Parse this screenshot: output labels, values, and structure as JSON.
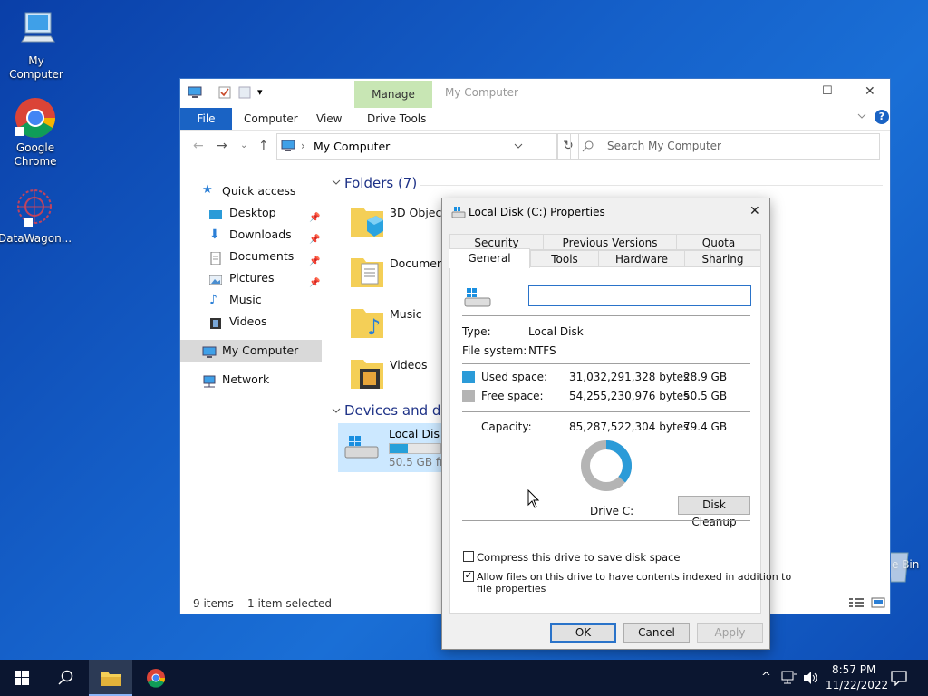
{
  "desktop": {
    "icons": [
      {
        "label": "My Computer"
      },
      {
        "label": "Google Chrome"
      },
      {
        "label": "DataWagon..."
      },
      {
        "label": "e Bin"
      }
    ]
  },
  "explorer": {
    "quick_access_toolbar": {
      "dropdown": "▾"
    },
    "contextual_tab": "Manage",
    "window_title": "My Computer",
    "controls": {
      "minimize": "—",
      "maximize": "☐",
      "close": "✕"
    },
    "ribbon_tabs": [
      "File",
      "Computer",
      "View",
      "Drive Tools"
    ],
    "help": "?",
    "address": {
      "path": "My Computer",
      "separator": "›"
    },
    "search": {
      "placeholder": "Search My Computer"
    },
    "nav": {
      "items": [
        {
          "label": "Quick access",
          "pinned": false
        },
        {
          "label": "Desktop",
          "pinned": true
        },
        {
          "label": "Downloads",
          "pinned": true
        },
        {
          "label": "Documents",
          "pinned": true
        },
        {
          "label": "Pictures",
          "pinned": true
        },
        {
          "label": "Music",
          "pinned": false
        },
        {
          "label": "Videos",
          "pinned": false
        },
        {
          "label": "My Computer",
          "pinned": false
        },
        {
          "label": "Network",
          "pinned": false
        }
      ]
    },
    "folders_header": "Folders (7)",
    "folders": [
      "3D Objects",
      "Documents",
      "Music",
      "Videos"
    ],
    "devices_header": "Devices and drives",
    "drive": {
      "name": "Local Disk (C:)",
      "free": "50.5 GB free of 79.4 GB",
      "used_fraction": 0.364
    },
    "status": {
      "items": "9 items",
      "selected": "1 item selected"
    }
  },
  "dialog": {
    "title": "Local Disk (C:) Properties",
    "close": "✕",
    "tabs_top": [
      "Security",
      "Previous Versions",
      "Quota"
    ],
    "tabs_bottom": [
      "General",
      "Tools",
      "Hardware",
      "Sharing"
    ],
    "name_value": "",
    "type_label": "Type:",
    "type_value": "Local Disk",
    "fs_label": "File system:",
    "fs_value": "NTFS",
    "used_label": "Used space:",
    "used_bytes": "31,032,291,328 bytes",
    "used_gb": "28.9 GB",
    "free_label": "Free space:",
    "free_bytes": "54,255,230,976 bytes",
    "free_gb": "50.5 GB",
    "capacity_label": "Capacity:",
    "capacity_bytes": "85,287,522,304 bytes",
    "capacity_gb": "79.4 GB",
    "drive_label": "Drive C:",
    "cleanup_button": "Disk Cleanup",
    "compress_label": "Compress this drive to save disk space",
    "compress_checked": false,
    "index_label_1": "Allow files on this drive to have contents indexed in addition to",
    "index_label_2": "file properties",
    "index_checked": true,
    "check_mark": "✓",
    "ok": "OK",
    "cancel": "Cancel",
    "apply": "Apply",
    "colors": {
      "used": "#2b9bd8",
      "free": "#b4b4b4"
    }
  },
  "taskbar": {
    "time": "8:57 PM",
    "date": "11/22/2022",
    "tray_chevron": "^"
  }
}
